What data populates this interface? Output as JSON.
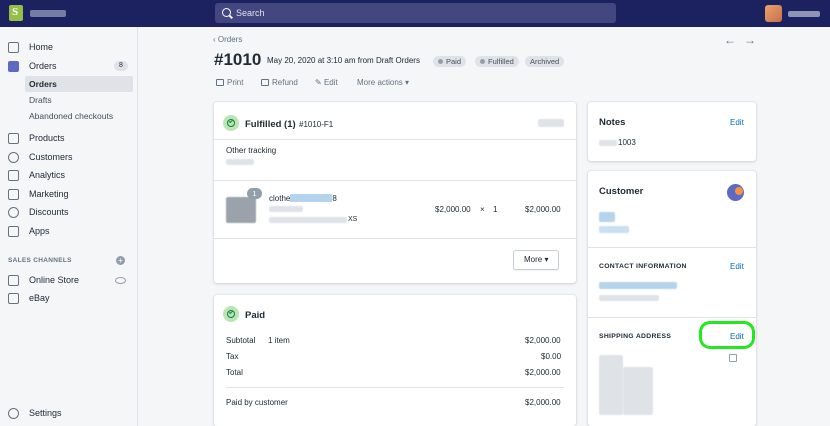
{
  "topbar": {
    "search_placeholder": "Search"
  },
  "sidebar": {
    "items": [
      {
        "label": "Home"
      },
      {
        "label": "Orders",
        "badge": "8"
      },
      {
        "label": "Products"
      },
      {
        "label": "Customers"
      },
      {
        "label": "Analytics"
      },
      {
        "label": "Marketing"
      },
      {
        "label": "Discounts"
      },
      {
        "label": "Apps"
      }
    ],
    "orders_sub": [
      "Orders",
      "Drafts",
      "Abandoned checkouts"
    ],
    "sales_channels_label": "SALES CHANNELS",
    "channels": [
      "Online Store",
      "eBay"
    ],
    "settings_label": "Settings"
  },
  "header": {
    "breadcrumb": "Orders",
    "title": "#1010",
    "meta": "May 20, 2020 at 3:10 am from Draft Orders",
    "pills": [
      "Paid",
      "Fulfilled",
      "Archived"
    ],
    "actions": {
      "print": "Print",
      "refund": "Refund",
      "edit": "Edit",
      "more": "More actions"
    }
  },
  "fulfilled": {
    "title": "Fulfilled (1)",
    "code": "#1010-F1",
    "tracking_label": "Other tracking",
    "qty_badge": "1",
    "item_name_prefix": "clothe",
    "item_name_suffix": "8",
    "item_variant_suffix": "XS",
    "price": "$2,000.00",
    "times": "×",
    "qty": "1",
    "line_total": "$2,000.00",
    "more_button": "More"
  },
  "paid": {
    "title": "Paid",
    "rows": [
      {
        "label": "Subtotal",
        "note": "1 item",
        "value": "$2,000.00"
      },
      {
        "label": "Tax",
        "note": "",
        "value": "$0.00"
      },
      {
        "label": "Total",
        "note": "",
        "value": "$2,000.00"
      }
    ],
    "paid_by_label": "Paid by customer",
    "paid_by_value": "$2,000.00"
  },
  "notes": {
    "title": "Notes",
    "edit": "Edit",
    "value": "1003"
  },
  "customer": {
    "title": "Customer",
    "contact_label": "CONTACT INFORMATION",
    "contact_edit": "Edit",
    "shipping_label": "SHIPPING ADDRESS",
    "shipping_edit": "Edit"
  },
  "colors": {
    "topbar": "#1c2260",
    "accent": "#5c6ac4",
    "link": "#006fbb",
    "highlight": "#22e81e"
  }
}
